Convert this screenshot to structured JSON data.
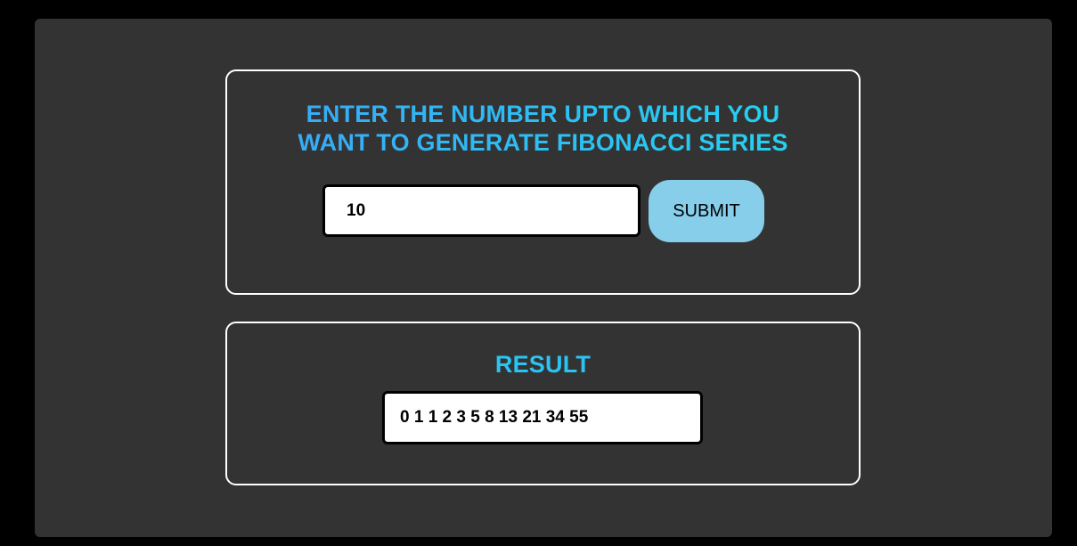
{
  "form": {
    "heading": "ENTER THE NUMBER UPTO WHICH YOU WANT TO GENERATE FIBONACCI SERIES",
    "input_value": "10",
    "submit_label": "SUBMIT"
  },
  "result": {
    "heading": "RESULT",
    "series_text": "0 1 1 2 3 5 8 13 21 34 55"
  },
  "colors": {
    "page_background": "#000000",
    "panel_background": "#333333",
    "heading_gradient_start": "#3aa6f7",
    "heading_gradient_end": "#22d6f0",
    "submit_button": "#87ceeb"
  }
}
